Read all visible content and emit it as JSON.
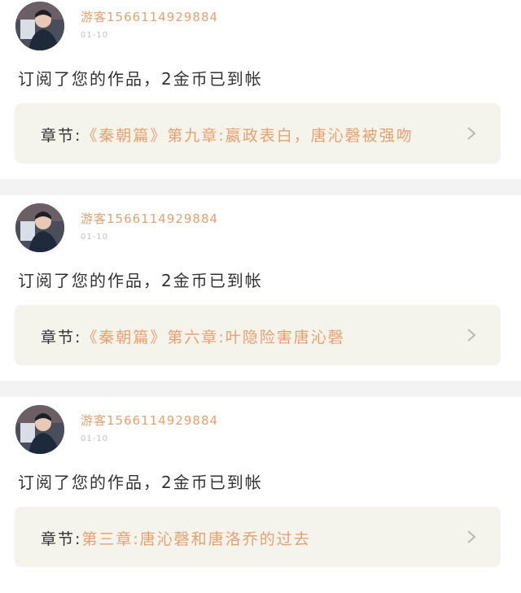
{
  "items": [
    {
      "username": "游客15661149​29884",
      "date": "01-10",
      "message": "订阅了您的作品，2金币已到帐",
      "chapter_prefix": "章节:",
      "chapter_title": "《秦朝篇》第九章:嬴政表白，唐沁磬被强吻"
    },
    {
      "username": "游客1566114929884",
      "date": "01-10",
      "message": "订阅了您的作品，2金币已到帐",
      "chapter_prefix": "章节:",
      "chapter_title": "《秦朝篇》第六章:叶隐险害唐沁磬"
    },
    {
      "username": "游客1566114929884",
      "date": "01-10",
      "message": "订阅了您的作品，2金币已到帐",
      "chapter_prefix": "章节:",
      "chapter_title": "第三章:唐沁磬和唐洛乔的过去"
    }
  ],
  "icons": {
    "avatar": "user-avatar-photo",
    "chevron": "chevron-right-icon"
  },
  "colors": {
    "accent": "#e8a06d",
    "chapter_bg": "#f4f3ec",
    "separator": "#f3f3f3"
  }
}
